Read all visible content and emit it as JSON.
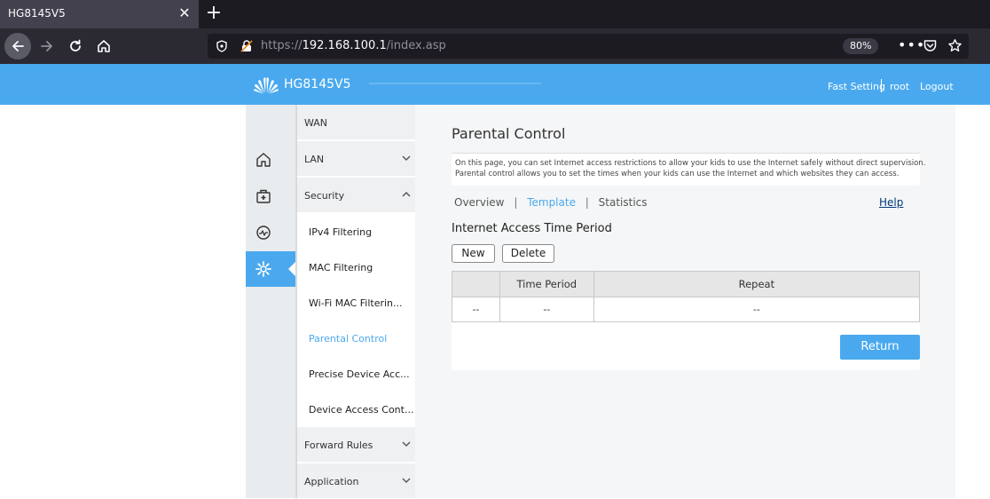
{
  "browser": {
    "tab_title": "HG8145V5",
    "tab_close": "✕",
    "new_tab": "+",
    "url_prefix": "https://",
    "url_host": "192.168.100.1",
    "url_path": "/index.asp",
    "zoom": "80%",
    "more": "•••"
  },
  "header": {
    "model": "HG8145V5",
    "fast_setting": "Fast Setting",
    "user": "root",
    "logout": "Logout",
    "color": "#4aa9ee"
  },
  "icon_nav": [
    "home-icon",
    "medical-kit-icon",
    "pulse-icon",
    "gear-icon"
  ],
  "menu": {
    "wan": "WAN",
    "lan": "LAN",
    "security": "Security",
    "security_items": [
      "IPv4 Filtering",
      "MAC Filtering",
      "Wi-Fi MAC Filterin...",
      "Parental Control",
      "Precise Device Acc...",
      "Device Access Cont..."
    ],
    "forward_rules": "Forward Rules",
    "application": "Application"
  },
  "page": {
    "title": "Parental Control",
    "description_line1": "On this page, you can set Internet access restrictions to allow your kids to use the Internet safely without direct supervision.",
    "description_line2": "Parental control allows you to set the times when your kids can use the Internet and which websites they can access.",
    "tabs": [
      "Overview",
      "Template",
      "Statistics"
    ],
    "tab_separator": "|",
    "active_tab": "Template",
    "help": "Help",
    "section_title": "Internet Access Time Period",
    "new_button": "New",
    "delete_button": "Delete",
    "table": {
      "headers": [
        "",
        "Time Period",
        "Repeat"
      ],
      "rows": [
        [
          "--",
          "--",
          "--"
        ]
      ]
    },
    "return_button": "Return"
  }
}
